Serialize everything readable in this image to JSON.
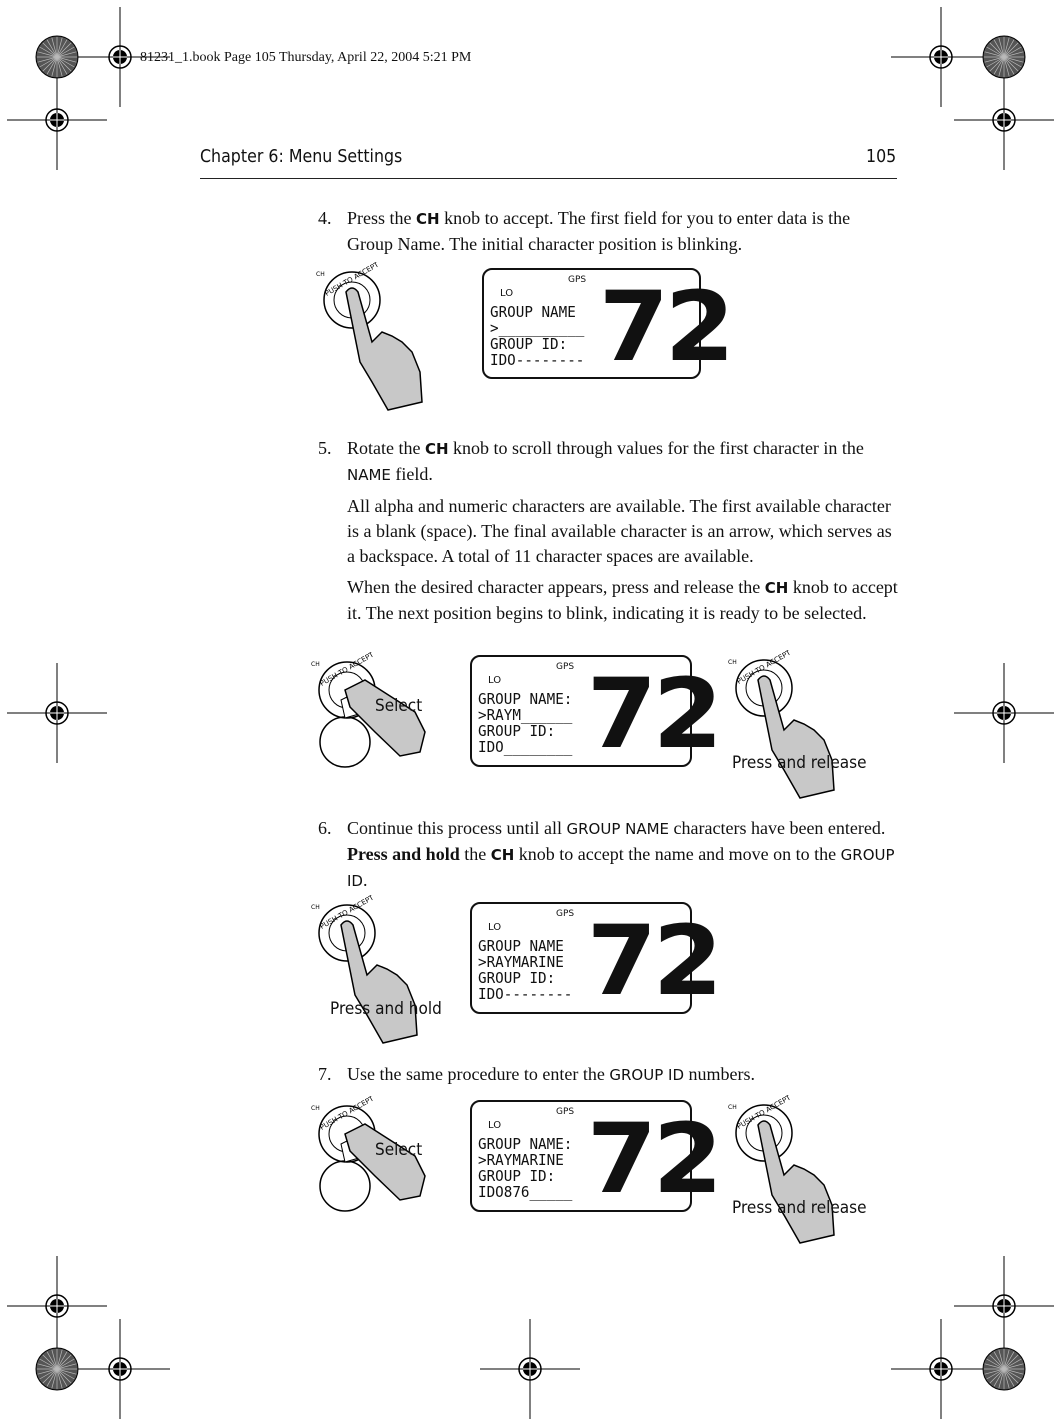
{
  "book_line": "81231_1.book  Page 105  Thursday, April 22, 2004  5:21 PM",
  "header": {
    "chapter": "Chapter 6: Menu Settings",
    "page_number": "105"
  },
  "steps": [
    {
      "number": "4.",
      "pre": "Press the ",
      "key": "CH",
      "post": " knob to accept. The first field for you to enter data is the Group Name. The initial character position is blinking."
    },
    {
      "number": "5.",
      "pre": "Rotate the ",
      "key": "CH",
      "mid": " knob to scroll through values for the first character in the ",
      "field": "NAME",
      "post": " field.",
      "para2": "All alpha and numeric characters are available. The first available character is a blank (space). The final available character is an arrow, which serves as a backspace. A total of 11 character spaces are available.",
      "para3_pre": "When the desired character appears, press and release the ",
      "para3_key": "CH",
      "para3_post": " knob to accept it. The next position begins to blink, indicating it is ready to be selected."
    },
    {
      "number": "6.",
      "pre": "Continue this process until all ",
      "field": "GROUP NAME",
      "mid": " characters have been entered. ",
      "bold": "Press and hold",
      "mid2": " the ",
      "key": "CH",
      "mid3": " knob to accept the name and move on to the ",
      "field2": "GROUP ID",
      "post": "."
    },
    {
      "number": "7.",
      "pre": "Use the same procedure to enter the ",
      "field": "GROUP ID",
      "post": " numbers."
    }
  ],
  "figures": [
    {
      "lcd": {
        "gps": "GPS",
        "lo": "LO",
        "lines": [
          "GROUP NAME",
          ">__________",
          "GROUP ID:",
          "IDO--------"
        ],
        "channel": "72"
      }
    },
    {
      "left_label": "Select",
      "right_label": "Press and release",
      "lcd": {
        "gps": "GPS",
        "lo": "LO",
        "lines": [
          "GROUP NAME:",
          ">RAYM______",
          "GROUP ID:",
          "IDO________"
        ],
        "channel": "72"
      }
    },
    {
      "left_label": "Press and hold",
      "lcd": {
        "gps": "GPS",
        "lo": "LO",
        "lines": [
          "GROUP NAME",
          ">RAYMARINE",
          "GROUP ID:",
          "IDO--------"
        ],
        "channel": "72"
      }
    },
    {
      "left_label": "Select",
      "right_label": "Press and release",
      "lcd": {
        "gps": "GPS",
        "lo": "LO",
        "lines": [
          "GROUP NAME:",
          ">RAYMARINE",
          "GROUP ID:",
          "IDO876_____"
        ],
        "channel": "72"
      }
    }
  ],
  "knob": {
    "ch": "CH",
    "ring": "PUSH TO ACCEPT"
  }
}
